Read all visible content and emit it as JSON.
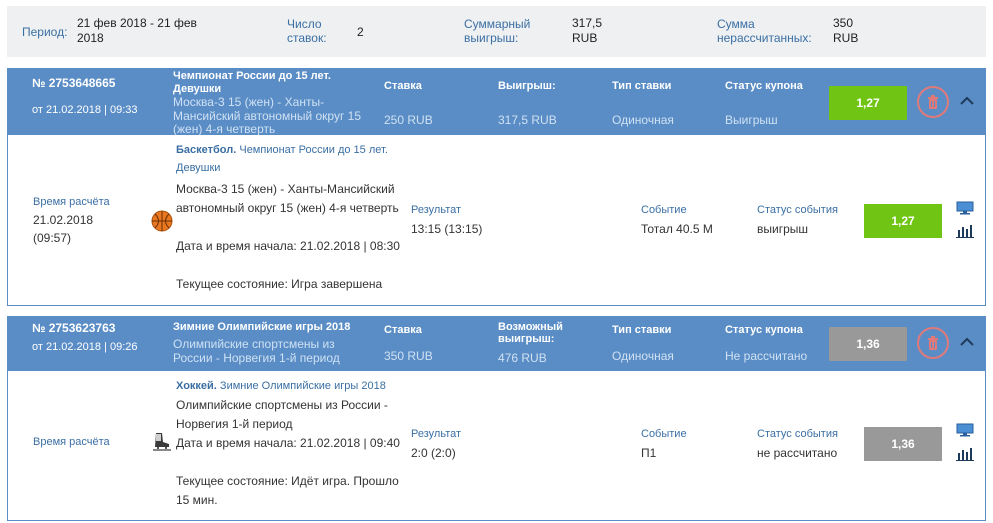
{
  "summary": {
    "period_label": "Период:",
    "period_value": "21 фев 2018 - 21 фев 2018",
    "bets_label": "Число ставок:",
    "bets_value": "2",
    "win_label": "Суммарный выигрыш:",
    "win_value": "317,5 RUB",
    "unsettled_label": "Сумма нерассчитанных:",
    "unsettled_value": "350 RUB"
  },
  "headers": {
    "stake": "Ставка",
    "win": "Выигрыш:",
    "possible_win": "Возможный выигрыш:",
    "type": "Тип ставки",
    "status": "Статус купона",
    "calc_time": "Время расчёта",
    "result": "Результат",
    "event": "Событие",
    "event_status": "Статус события"
  },
  "coupons": [
    {
      "number": "№ 2753648665",
      "date": "от 21.02.2018 | 09:33",
      "tournament": "Чемпионат России до 15 лет. Девушки",
      "event": "Москва-3 15 (жен) - Ханты-Мансийский автономный округ 15 (жен) 4-я четверть",
      "stake": "250 RUB",
      "win": "317,5 RUB",
      "type": "Одиночная",
      "status": "Выигрыш",
      "odds": "1,27",
      "odds_color": "#6fc414",
      "sport": "Баскетбол.",
      "league": "Чемпионат России до 15 лет. Девушки",
      "detail_event": "Москва-3 15 (жен) - Ханты-Мансийский автономный округ 15 (жен) 4-я четверть",
      "start": "Дата и время начала: 21.02.2018 | 08:30",
      "state": "Текущее состояние: Игра завершена",
      "calc_time": "21.02.2018 (09:57)",
      "result": "13:15 (13:15)",
      "bet_event": "Тотал 40.5 М",
      "event_status": "выигрыш",
      "icon": "basketball-icon"
    },
    {
      "number": "№ 2753623763",
      "date": "от 21.02.2018 | 09:26",
      "tournament": "Зимние Олимпийские игры 2018",
      "event": "Олимпийские спортсмены из России - Норвегия 1-й период",
      "stake": "350 RUB",
      "win": "476 RUB",
      "type": "Одиночная",
      "status": "Не рассчитано",
      "odds": "1,36",
      "odds_color": "#999999",
      "sport": "Хоккей.",
      "league": "Зимние Олимпийские игры 2018",
      "detail_event": "Олимпийские спортсмены из России - Норвегия 1-й период",
      "start": "Дата и время начала: 21.02.2018 | 09:40",
      "state": "Текущее состояние: Идёт игра. Прошло 15 мин.",
      "calc_time": "",
      "result": "2:0 (2:0)",
      "bet_event": "П1",
      "event_status": "не рассчитано",
      "icon": "hockey-skate-icon"
    }
  ]
}
